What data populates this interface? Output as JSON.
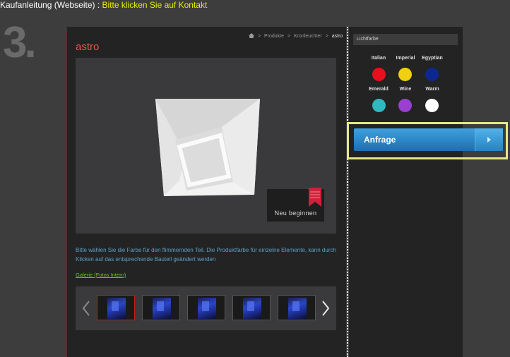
{
  "header": {
    "caption_prefix": "Kaufanleitung (Webseite)",
    "caption_separator": " : ",
    "caption_highlight": "Bitte klicken Sie auf Kontakt",
    "step_number": "3."
  },
  "breadcrumb": {
    "items": [
      "Produkte",
      "Kronleuchter"
    ],
    "current": "astro"
  },
  "product": {
    "title": "astro",
    "reset_label": "Neu beginnen",
    "info_text": "Bitte wählen Sie die Farbe für den flimmernden Teil. Die Produktfarbe für einzelne Elemente, kann durch Klicken auf das entsprechende Bauteil geändert werden",
    "gallery_link": "Galerie (Fotos Intern)",
    "thumbnail_count": 5,
    "selected_thumbnail": 1
  },
  "colors": {
    "accent_title": "#e05a4a",
    "info_text": "#5aa0c8",
    "gallery_link": "#78c020",
    "highlight_frame": "#e6e68a",
    "button_blue": "#2a8ad0"
  },
  "light_panel": {
    "header": "Lichtfarbe",
    "swatches": [
      {
        "label": "Italian",
        "color": "#e8101c"
      },
      {
        "label": "Imperial",
        "color": "#f0d010"
      },
      {
        "label": "Egyptian",
        "color": "#0c2890"
      },
      {
        "label": "Emerald",
        "color": "#30b8c0"
      },
      {
        "label": "Wine",
        "color": "#9a40d0"
      },
      {
        "label": "Warm",
        "color": "#ffffff"
      }
    ],
    "inquiry_label": "Anfrage"
  },
  "icons": [
    "home-icon",
    "bookmark-icon",
    "arrow-left-icon",
    "arrow-right-icon",
    "chevron-right-icon"
  ]
}
